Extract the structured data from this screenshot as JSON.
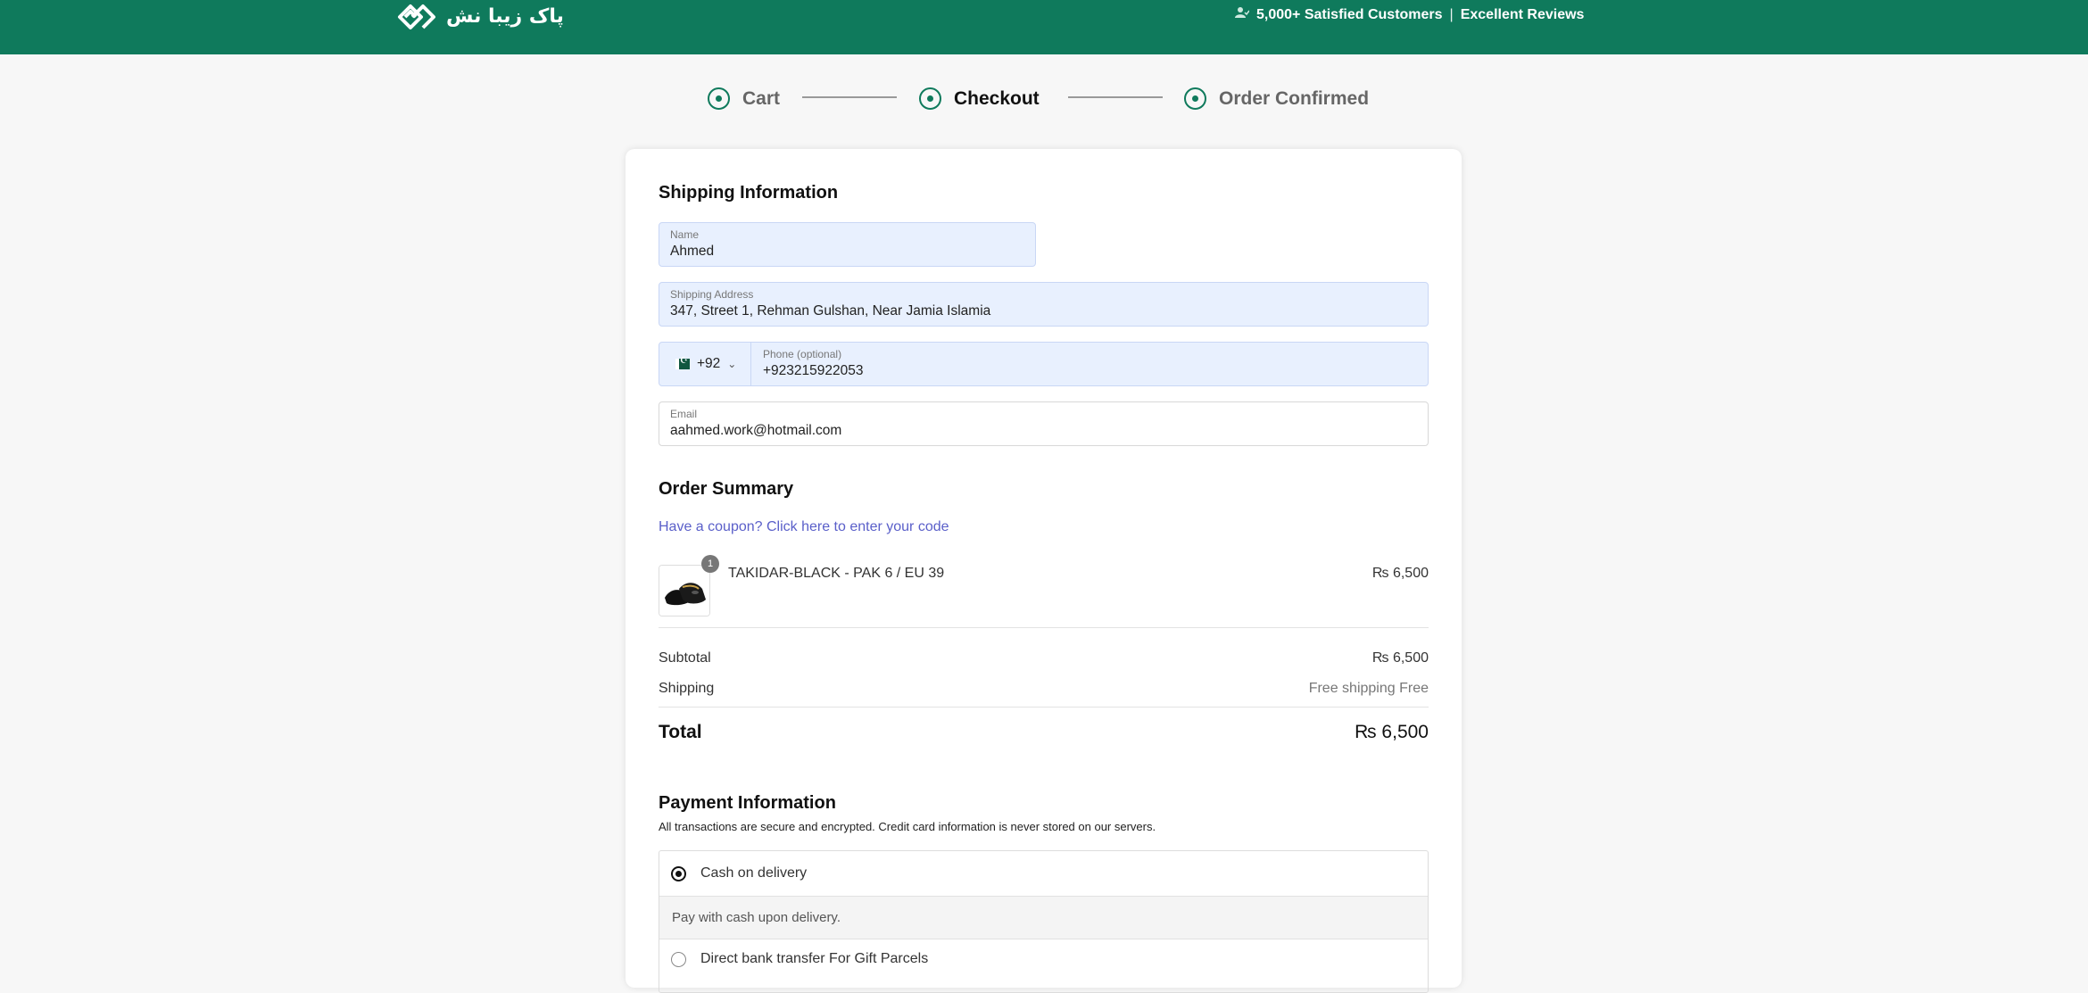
{
  "header": {
    "logo_text": "پاک زیبا نش",
    "customers": "5,000+ Satisfied Customers",
    "separator": "|",
    "reviews": "Excellent Reviews",
    "brand_color": "#0f7a5c"
  },
  "steps": [
    {
      "label": "Cart"
    },
    {
      "label": "Checkout"
    },
    {
      "label": "Order Confirmed"
    }
  ],
  "shipping": {
    "title": "Shipping Information",
    "name_label": "Name",
    "name_value": "Ahmed",
    "address_label": "Shipping Address",
    "address_value": "347, Street 1, Rehman Gulshan, Near Jamia Islamia",
    "phone_code": "+92",
    "phone_label": "Phone (optional)",
    "phone_value": "+923215922053",
    "email_label": "Email",
    "email_value": "aahmed.work@hotmail.com"
  },
  "summary": {
    "title": "Order Summary",
    "coupon_link": "Have a coupon? Click here to enter your code",
    "item": {
      "qty": "1",
      "name": "TAKIDAR-BLACK - PAK 6 / EU 39",
      "price": "₨ 6,500"
    },
    "subtotal_label": "Subtotal",
    "subtotal_value": "₨ 6,500",
    "shipping_label": "Shipping",
    "shipping_value": "Free shipping Free",
    "total_label": "Total",
    "total_value": "₨ 6,500"
  },
  "payment": {
    "title": "Payment Information",
    "subtitle": "All transactions are secure and encrypted. Credit card information is never stored on our servers.",
    "options": [
      {
        "label": "Cash on delivery",
        "selected": true,
        "description": "Pay with cash upon delivery."
      },
      {
        "label": "Direct bank transfer For Gift Parcels",
        "selected": false
      }
    ]
  }
}
